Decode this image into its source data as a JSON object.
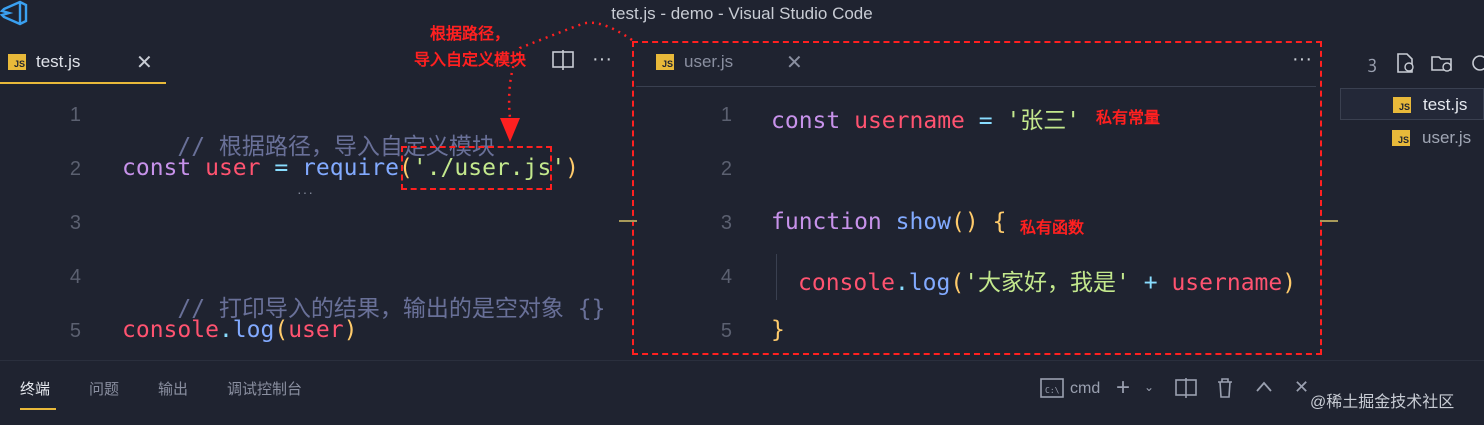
{
  "window": {
    "title": "test.js - demo - Visual Studio Code"
  },
  "left_editor": {
    "tab": {
      "badge": "JS",
      "label": "test.js",
      "close": "✕"
    },
    "lines": [
      {
        "num": "1",
        "comment": "// 根据路径，导入自定义模块"
      },
      {
        "num": "2",
        "kw": "const",
        "var": "user",
        "op": " = ",
        "fn": "require",
        "lp": "(",
        "str": "'./user.js'",
        "rp": ")"
      },
      {
        "num": "3"
      },
      {
        "num": "4",
        "comment": "// 打印导入的结果，输出的是空对象 {}"
      },
      {
        "num": "5",
        "var": "console",
        "dot": ".",
        "fn": "log",
        "lp": "(",
        "arg": "user",
        "rp": ")"
      }
    ]
  },
  "right_editor": {
    "tab": {
      "badge": "JS",
      "label": "user.js",
      "close": "✕"
    },
    "more": "···",
    "lines": [
      {
        "num": "1",
        "kw": "const",
        "var": "username",
        "op": " = ",
        "str": "'张三'"
      },
      {
        "num": "2"
      },
      {
        "num": "3",
        "kw": "function",
        "fn": "show",
        "paren": "()",
        "brace": "{"
      },
      {
        "num": "4",
        "var": "console",
        "dot": ".",
        "fn": "log",
        "lp": "(",
        "str": "'大家好，我是'",
        "plus": " + ",
        "arg": "username",
        "rp": ")"
      },
      {
        "num": "5",
        "brace": "}"
      }
    ]
  },
  "split_toolbar": {
    "split_icon": "split-editor-icon",
    "more": "···"
  },
  "annotations": {
    "path_note": "根据路径，\n导入自定义模块",
    "private_const": "私有常量",
    "private_func": "私有函数"
  },
  "explorer": {
    "files": [
      {
        "badge": "JS",
        "label": "test.js",
        "active": true
      },
      {
        "badge": "JS",
        "label": "user.js",
        "active": false
      }
    ]
  },
  "panel": {
    "tabs": [
      "终端",
      "问题",
      "输出",
      "调试控制台"
    ],
    "shell": "cmd",
    "watermark": "@稀土掘金技术社区"
  },
  "colors": {
    "accent": "#e8b93a",
    "annotation": "#ff2020",
    "background": "#1f2330"
  }
}
